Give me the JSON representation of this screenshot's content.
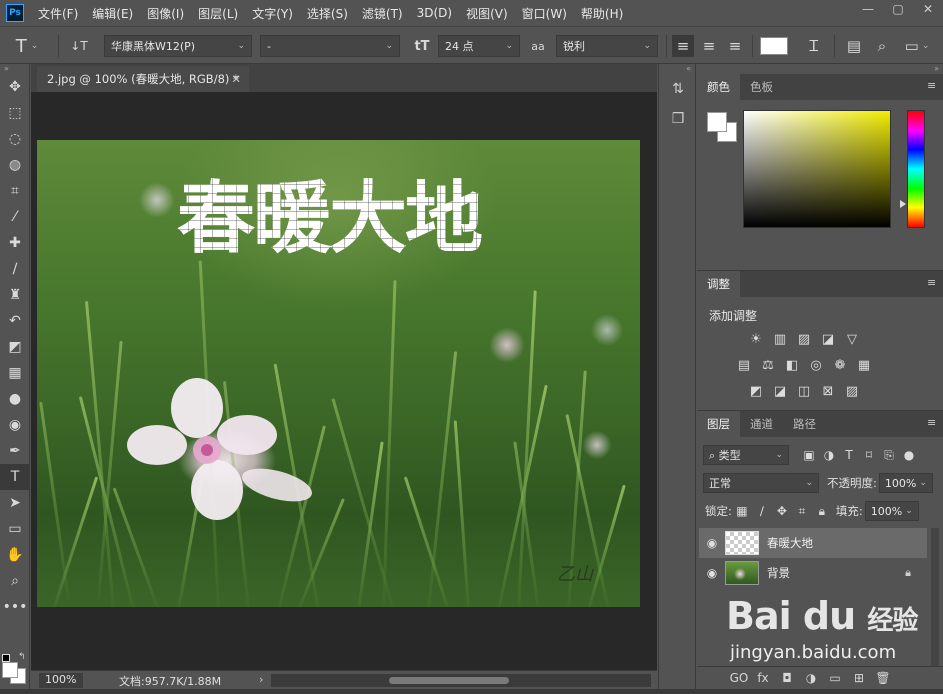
{
  "menubar": {
    "logo": "Ps",
    "items": [
      "文件(F)",
      "编辑(E)",
      "图像(I)",
      "图层(L)",
      "文字(Y)",
      "选择(S)",
      "滤镜(T)",
      "3D(D)",
      "视图(V)",
      "窗口(W)",
      "帮助(H)"
    ],
    "window_controls": [
      "—",
      "▢",
      "✕"
    ]
  },
  "options": {
    "tool_icon": "T",
    "orient_icon": "↓T",
    "font_family": "华康黑体W12(P)",
    "font_style": "-",
    "size_icon": "tT",
    "font_size": "24 点",
    "aa_icon": "aa",
    "antialias": "锐利",
    "color_swatch": "#ffffff"
  },
  "toolbar": {
    "tools": [
      {
        "name": "move-tool",
        "glyph": "✥"
      },
      {
        "name": "marquee-tool",
        "glyph": "⬚"
      },
      {
        "name": "lasso-tool",
        "glyph": "◌"
      },
      {
        "name": "quick-select-tool",
        "glyph": "◍"
      },
      {
        "name": "crop-tool",
        "glyph": "⌗"
      },
      {
        "name": "eyedropper-tool",
        "glyph": "⁄"
      },
      {
        "name": "healing-tool",
        "glyph": "✚"
      },
      {
        "name": "brush-tool",
        "glyph": "∕"
      },
      {
        "name": "stamp-tool",
        "glyph": "♜"
      },
      {
        "name": "history-brush-tool",
        "glyph": "↶"
      },
      {
        "name": "eraser-tool",
        "glyph": "◩"
      },
      {
        "name": "gradient-tool",
        "glyph": "▦"
      },
      {
        "name": "blur-tool",
        "glyph": "●"
      },
      {
        "name": "dodge-tool",
        "glyph": "◉"
      },
      {
        "name": "pen-tool",
        "glyph": "✒"
      },
      {
        "name": "type-tool",
        "glyph": "T"
      },
      {
        "name": "path-select-tool",
        "glyph": "➤"
      },
      {
        "name": "rectangle-tool",
        "glyph": "▭"
      },
      {
        "name": "hand-tool",
        "glyph": "✋"
      },
      {
        "name": "zoom-tool",
        "glyph": "⌕"
      },
      {
        "name": "more-tools",
        "glyph": "•••"
      }
    ],
    "active_index": 15
  },
  "document": {
    "tab_title": "2.jpg @ 100% (春暖大地, RGB/8) *",
    "tab_close": "✕",
    "headline": "春暖大地",
    "signature": "乙山"
  },
  "status": {
    "zoom": "100%",
    "doc_info": "文档:957.7K/1.88M",
    "arrow": "›"
  },
  "color_panel": {
    "tabs": [
      "颜色",
      "色板"
    ],
    "active": 0
  },
  "adjustments_panel": {
    "tabs": [
      "调整"
    ],
    "title": "添加调整",
    "row1": [
      "☀",
      "▥",
      "▨",
      "◪",
      "▽"
    ],
    "row2": [
      "▤",
      "⚖",
      "◧",
      "◎",
      "❁",
      "▦"
    ],
    "row3": [
      "◩",
      "◪",
      "◫",
      "⊠",
      "▨"
    ]
  },
  "layers_panel": {
    "tabs": [
      "图层",
      "通道",
      "路径"
    ],
    "active": 0,
    "filter_label": "类型",
    "blend_mode": "正常",
    "opacity_label": "不透明度:",
    "opacity": "100%",
    "lock_label": "锁定:",
    "fill_label": "填充:",
    "fill": "100%",
    "layers": [
      {
        "name": "春暖大地",
        "type": "text",
        "selected": true
      },
      {
        "name": "背景",
        "type": "image",
        "selected": false,
        "locked": true
      }
    ],
    "footer_icons": [
      "GO",
      "fx",
      "◘",
      "◑",
      "▭",
      "⊞",
      "🗑"
    ]
  },
  "watermark": {
    "brand": "Bai du",
    "brand_cn": "经验",
    "url": "jingyan.baidu.com"
  }
}
